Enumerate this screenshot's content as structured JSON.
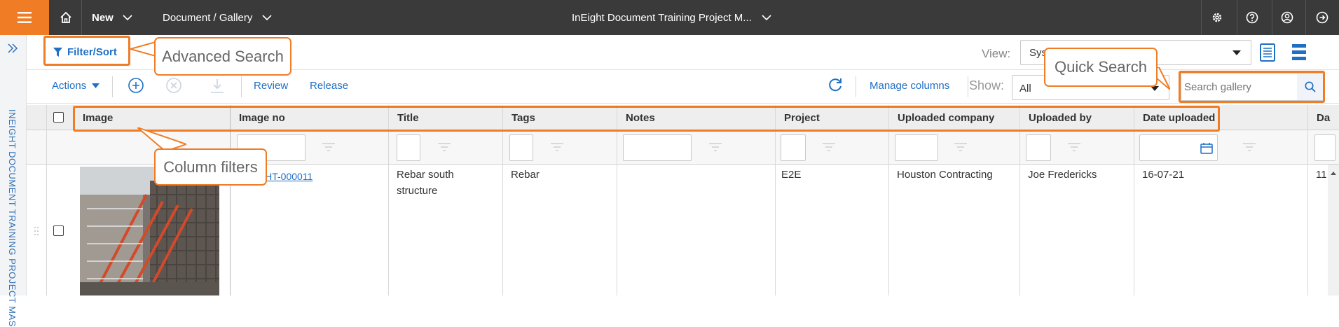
{
  "topbar": {
    "new_label": "New",
    "doc_label": "Document / Gallery",
    "project_label": "InEight Document Training Project M...",
    "icons": [
      "menu-icon",
      "home-icon",
      "settings-icon",
      "help-icon",
      "user-icon",
      "logout-icon"
    ]
  },
  "sidebar": {
    "project_vertical": "INEIGHT DOCUMENT TRAINING PROJECT MAS"
  },
  "toolbar1": {
    "filter_sort": "Filter/Sort",
    "view_label": "View:",
    "view_value": "Sys"
  },
  "toolbar2": {
    "actions": "Actions",
    "review": "Review",
    "release": "Release",
    "manage_columns": "Manage columns",
    "show_label": "Show:",
    "show_value": "All",
    "search_placeholder": "Search gallery"
  },
  "callouts": {
    "advanced_search": "Advanced Search",
    "quick_search": "Quick Search",
    "column_filters": "Column filters"
  },
  "grid": {
    "columns": [
      "Image",
      "Image no",
      "Title",
      "Tags",
      "Notes",
      "Project",
      "Uploaded company",
      "Uploaded by",
      "Date uploaded",
      "Da"
    ],
    "rows": [
      {
        "image_no": "EIGHT-000011",
        "title": "Rebar south structure",
        "tags": "Rebar",
        "notes": "",
        "project": "E2E",
        "uploaded_company": "Houston Contracting",
        "uploaded_by": "Joe Fredericks",
        "date_uploaded": "16-07-21",
        "extra": "11"
      }
    ]
  },
  "colors": {
    "accent": "#f07c26",
    "topbar": "#3a3a3a",
    "link": "#1f6fc5"
  }
}
